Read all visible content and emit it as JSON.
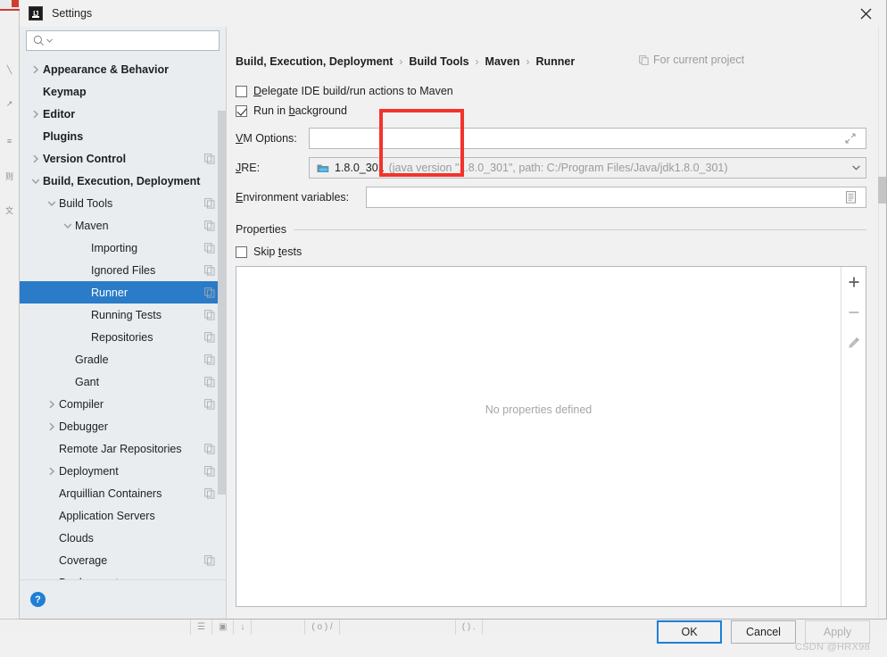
{
  "window": {
    "title": "Settings",
    "logo_text": "IJ",
    "close_icon": "close-icon"
  },
  "sidebar": {
    "search": {
      "placeholder": "",
      "value": "",
      "icon": "search-icon",
      "dropdown_icon": "chevron-down-icon"
    },
    "help_button": {
      "label": "?",
      "name": "help-icon"
    },
    "items": [
      {
        "label": "Appearance & Behavior",
        "indent": 0,
        "arrow": "right",
        "bold": true,
        "copy": false,
        "selected": false
      },
      {
        "label": "Keymap",
        "indent": 0,
        "arrow": "none",
        "bold": true,
        "copy": false,
        "selected": false
      },
      {
        "label": "Editor",
        "indent": 0,
        "arrow": "right",
        "bold": true,
        "copy": false,
        "selected": false
      },
      {
        "label": "Plugins",
        "indent": 0,
        "arrow": "none",
        "bold": true,
        "copy": false,
        "selected": false
      },
      {
        "label": "Version Control",
        "indent": 0,
        "arrow": "right",
        "bold": true,
        "copy": true,
        "selected": false
      },
      {
        "label": "Build, Execution, Deployment",
        "indent": 0,
        "arrow": "down",
        "bold": true,
        "copy": false,
        "selected": false
      },
      {
        "label": "Build Tools",
        "indent": 1,
        "arrow": "down",
        "bold": false,
        "copy": true,
        "selected": false
      },
      {
        "label": "Maven",
        "indent": 2,
        "arrow": "down",
        "bold": false,
        "copy": true,
        "selected": false
      },
      {
        "label": "Importing",
        "indent": 3,
        "arrow": "none",
        "bold": false,
        "copy": true,
        "selected": false
      },
      {
        "label": "Ignored Files",
        "indent": 3,
        "arrow": "none",
        "bold": false,
        "copy": true,
        "selected": false
      },
      {
        "label": "Runner",
        "indent": 3,
        "arrow": "none",
        "bold": false,
        "copy": true,
        "selected": true
      },
      {
        "label": "Running Tests",
        "indent": 3,
        "arrow": "none",
        "bold": false,
        "copy": true,
        "selected": false
      },
      {
        "label": "Repositories",
        "indent": 3,
        "arrow": "none",
        "bold": false,
        "copy": true,
        "selected": false
      },
      {
        "label": "Gradle",
        "indent": 2,
        "arrow": "none",
        "bold": false,
        "copy": true,
        "selected": false
      },
      {
        "label": "Gant",
        "indent": 2,
        "arrow": "none",
        "bold": false,
        "copy": true,
        "selected": false
      },
      {
        "label": "Compiler",
        "indent": 1,
        "arrow": "right",
        "bold": false,
        "copy": true,
        "selected": false
      },
      {
        "label": "Debugger",
        "indent": 1,
        "arrow": "right",
        "bold": false,
        "copy": false,
        "selected": false
      },
      {
        "label": "Remote Jar Repositories",
        "indent": 1,
        "arrow": "none",
        "bold": false,
        "copy": true,
        "selected": false
      },
      {
        "label": "Deployment",
        "indent": 1,
        "arrow": "right",
        "bold": false,
        "copy": true,
        "selected": false
      },
      {
        "label": "Arquillian Containers",
        "indent": 1,
        "arrow": "none",
        "bold": false,
        "copy": true,
        "selected": false
      },
      {
        "label": "Application Servers",
        "indent": 1,
        "arrow": "none",
        "bold": false,
        "copy": false,
        "selected": false
      },
      {
        "label": "Clouds",
        "indent": 1,
        "arrow": "none",
        "bold": false,
        "copy": false,
        "selected": false
      },
      {
        "label": "Coverage",
        "indent": 1,
        "arrow": "none",
        "bold": false,
        "copy": true,
        "selected": false
      },
      {
        "label": "Deployment",
        "indent": 1,
        "arrow": "none",
        "bold": false,
        "copy": false,
        "selected": false
      }
    ]
  },
  "main": {
    "breadcrumb": [
      "Build, Execution, Deployment",
      "Build Tools",
      "Maven",
      "Runner"
    ],
    "breadcrumb_separator": "›",
    "scope_label": "For current project",
    "scope_icon": "copy-icon",
    "checkboxes": [
      {
        "label": "Delegate IDE build/run actions to Maven",
        "checked": false,
        "mnemonic": "D"
      },
      {
        "label": "Run in background",
        "checked": true,
        "mnemonic": "b"
      }
    ],
    "vm_options": {
      "label": "VM Options:",
      "value": "",
      "placeholder": "",
      "expand_icon": "expand-arrows-icon"
    },
    "jre": {
      "label": "JRE:",
      "icon": "jdk-folder-icon",
      "name": "1.8.0_301",
      "detail": "(java version \"1.8.0_301\", path: C:/Program Files/Java/jdk1.8.0_301)",
      "dropdown_icon": "chevron-down-icon"
    },
    "env_vars": {
      "label": "Environment variables:",
      "value": "",
      "placeholder": "",
      "browse_icon": "list-document-icon"
    },
    "properties": {
      "group_title": "Properties",
      "skip_tests": {
        "label": "Skip tests",
        "checked": false,
        "mnemonic": "t"
      },
      "empty_text": "No properties defined",
      "toolbar": [
        {
          "name": "add-property-button",
          "icon": "plus-icon"
        },
        {
          "name": "remove-property-button",
          "icon": "minus-icon"
        },
        {
          "name": "edit-property-button",
          "icon": "pencil-icon"
        }
      ]
    }
  },
  "footer": {
    "ok": "OK",
    "cancel": "Cancel",
    "apply": "Apply",
    "apply_disabled": true,
    "watermark": "CSDN @HRX98"
  },
  "colors": {
    "accent": "#2a7bc8",
    "focus_border": "#1f7fd6",
    "annotation_red": "#f4322c",
    "sidebar_bg": "#e9edf0",
    "dialog_bg": "#f1f1f1"
  },
  "annotation": {
    "type": "red-rectangle",
    "covers": [
      "VM Options field left edge",
      "JRE label",
      "Environment variables field left edge"
    ]
  },
  "background_ide": {
    "bottom_segments": [
      "☰",
      "▣",
      "↓",
      "( o ) /",
      "( ) ."
    ],
    "rail_items": [
      "╲",
      "↗",
      "≡",
      "则",
      "文"
    ]
  }
}
